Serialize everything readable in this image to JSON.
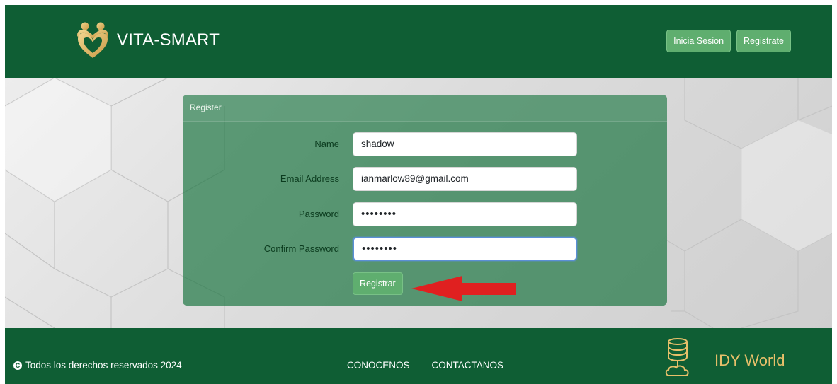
{
  "brand": {
    "name": "VITA-SMART",
    "logo_icon": "heart-family-icon"
  },
  "nav": {
    "login_label": "Inicia Sesion",
    "register_label": "Registrate"
  },
  "register_form": {
    "title": "Register",
    "fields": [
      {
        "label": "Name",
        "value": "shadow"
      },
      {
        "label": "Email Address",
        "value": "ianmarlow89@gmail.com"
      },
      {
        "label": "Password",
        "value": "••••••••"
      },
      {
        "label": "Confirm Password",
        "value": "••••••••"
      }
    ],
    "submit_label": "Registrar"
  },
  "footer": {
    "copyright": "Todos los derechos reservados 2024",
    "copyright_icon": "copyright-icon",
    "links": [
      "CONOCENOS",
      "CONTACTANOS"
    ],
    "partner_name": "IDY World",
    "partner_icon": "server-cloud-icon"
  },
  "colors": {
    "header_green": "#0f5e34",
    "button_green": "#5fae6f",
    "card_green": "#12703a",
    "partner_gold": "#e8c06a",
    "annotation_red": "#e02020"
  }
}
